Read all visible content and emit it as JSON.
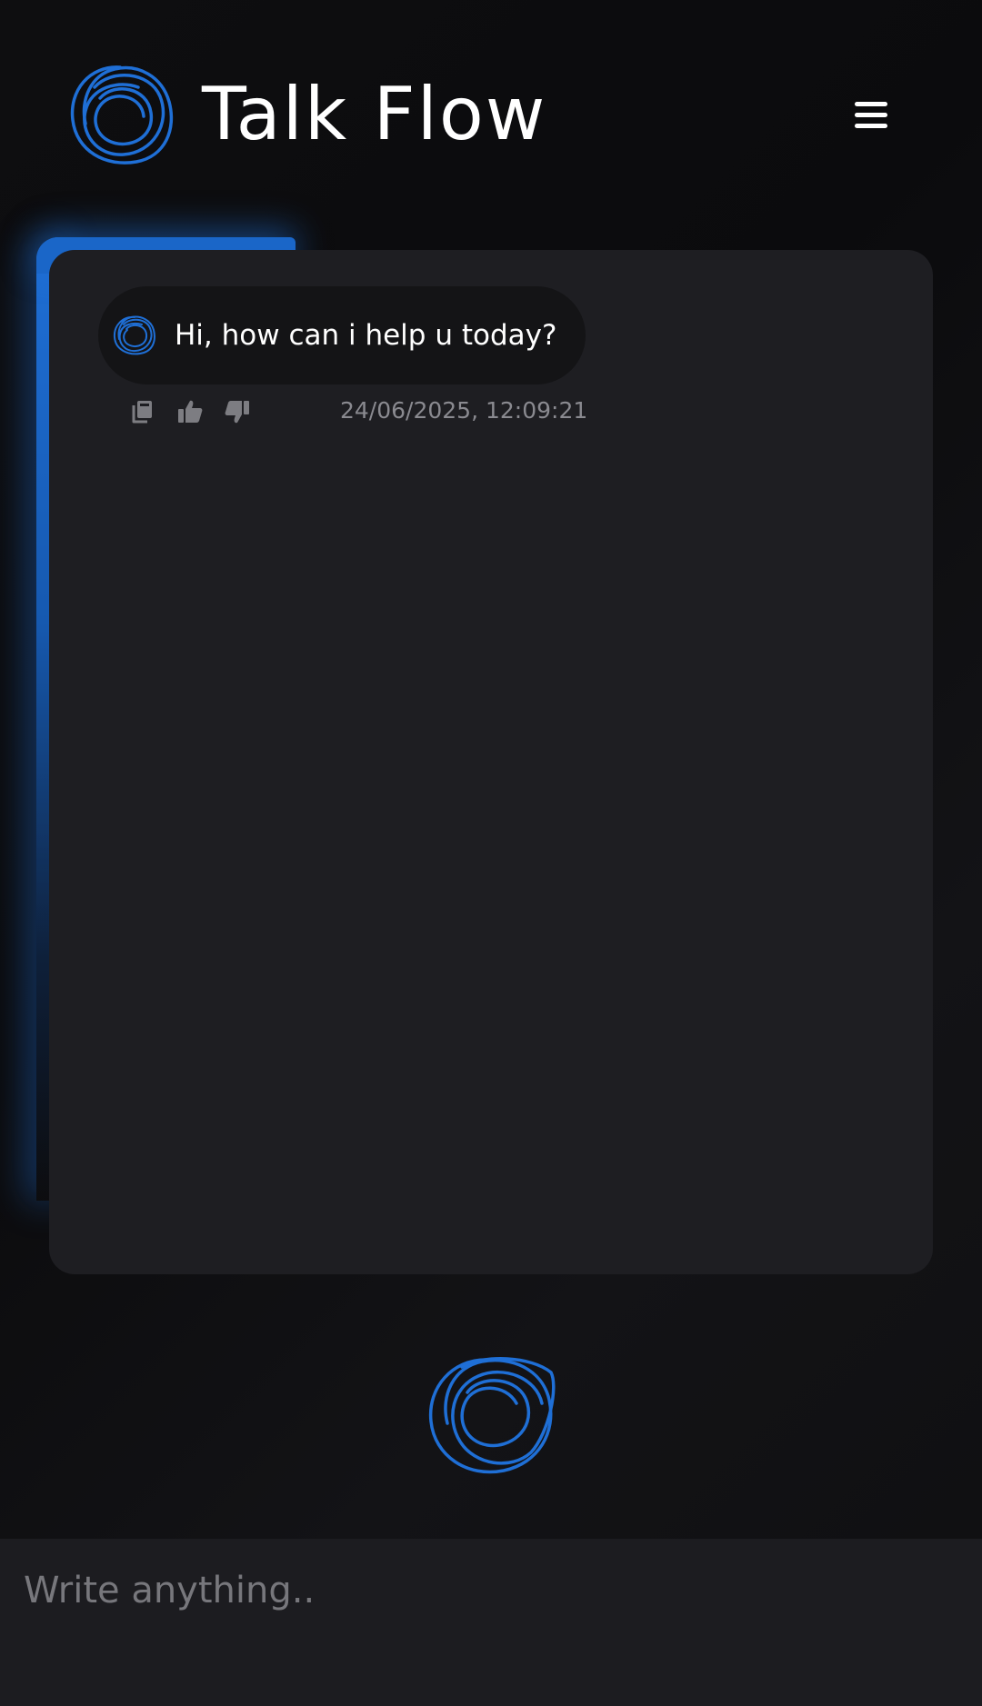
{
  "header": {
    "title": "Talk Flow",
    "logo_icon": "scribble-circle-logo-icon",
    "menu_icon": "hamburger-menu-icon"
  },
  "chat": {
    "messages": [
      {
        "avatar_icon": "scribble-circle-avatar-icon",
        "text": "Hi, how can i help u today?",
        "timestamp": "24/06/2025, 12:09:21",
        "actions": [
          "copy-icon",
          "thumbs-up-icon",
          "thumbs-down-icon"
        ]
      }
    ]
  },
  "center_orb_icon": "scribble-circle-orb-icon",
  "input": {
    "placeholder": "Write anything..",
    "value": ""
  },
  "colors": {
    "accent": "#1f6fd6",
    "background": "#0e0e10",
    "panel": "#1e1e22",
    "bubble": "#141416",
    "timestamp": "#8a8a90"
  }
}
